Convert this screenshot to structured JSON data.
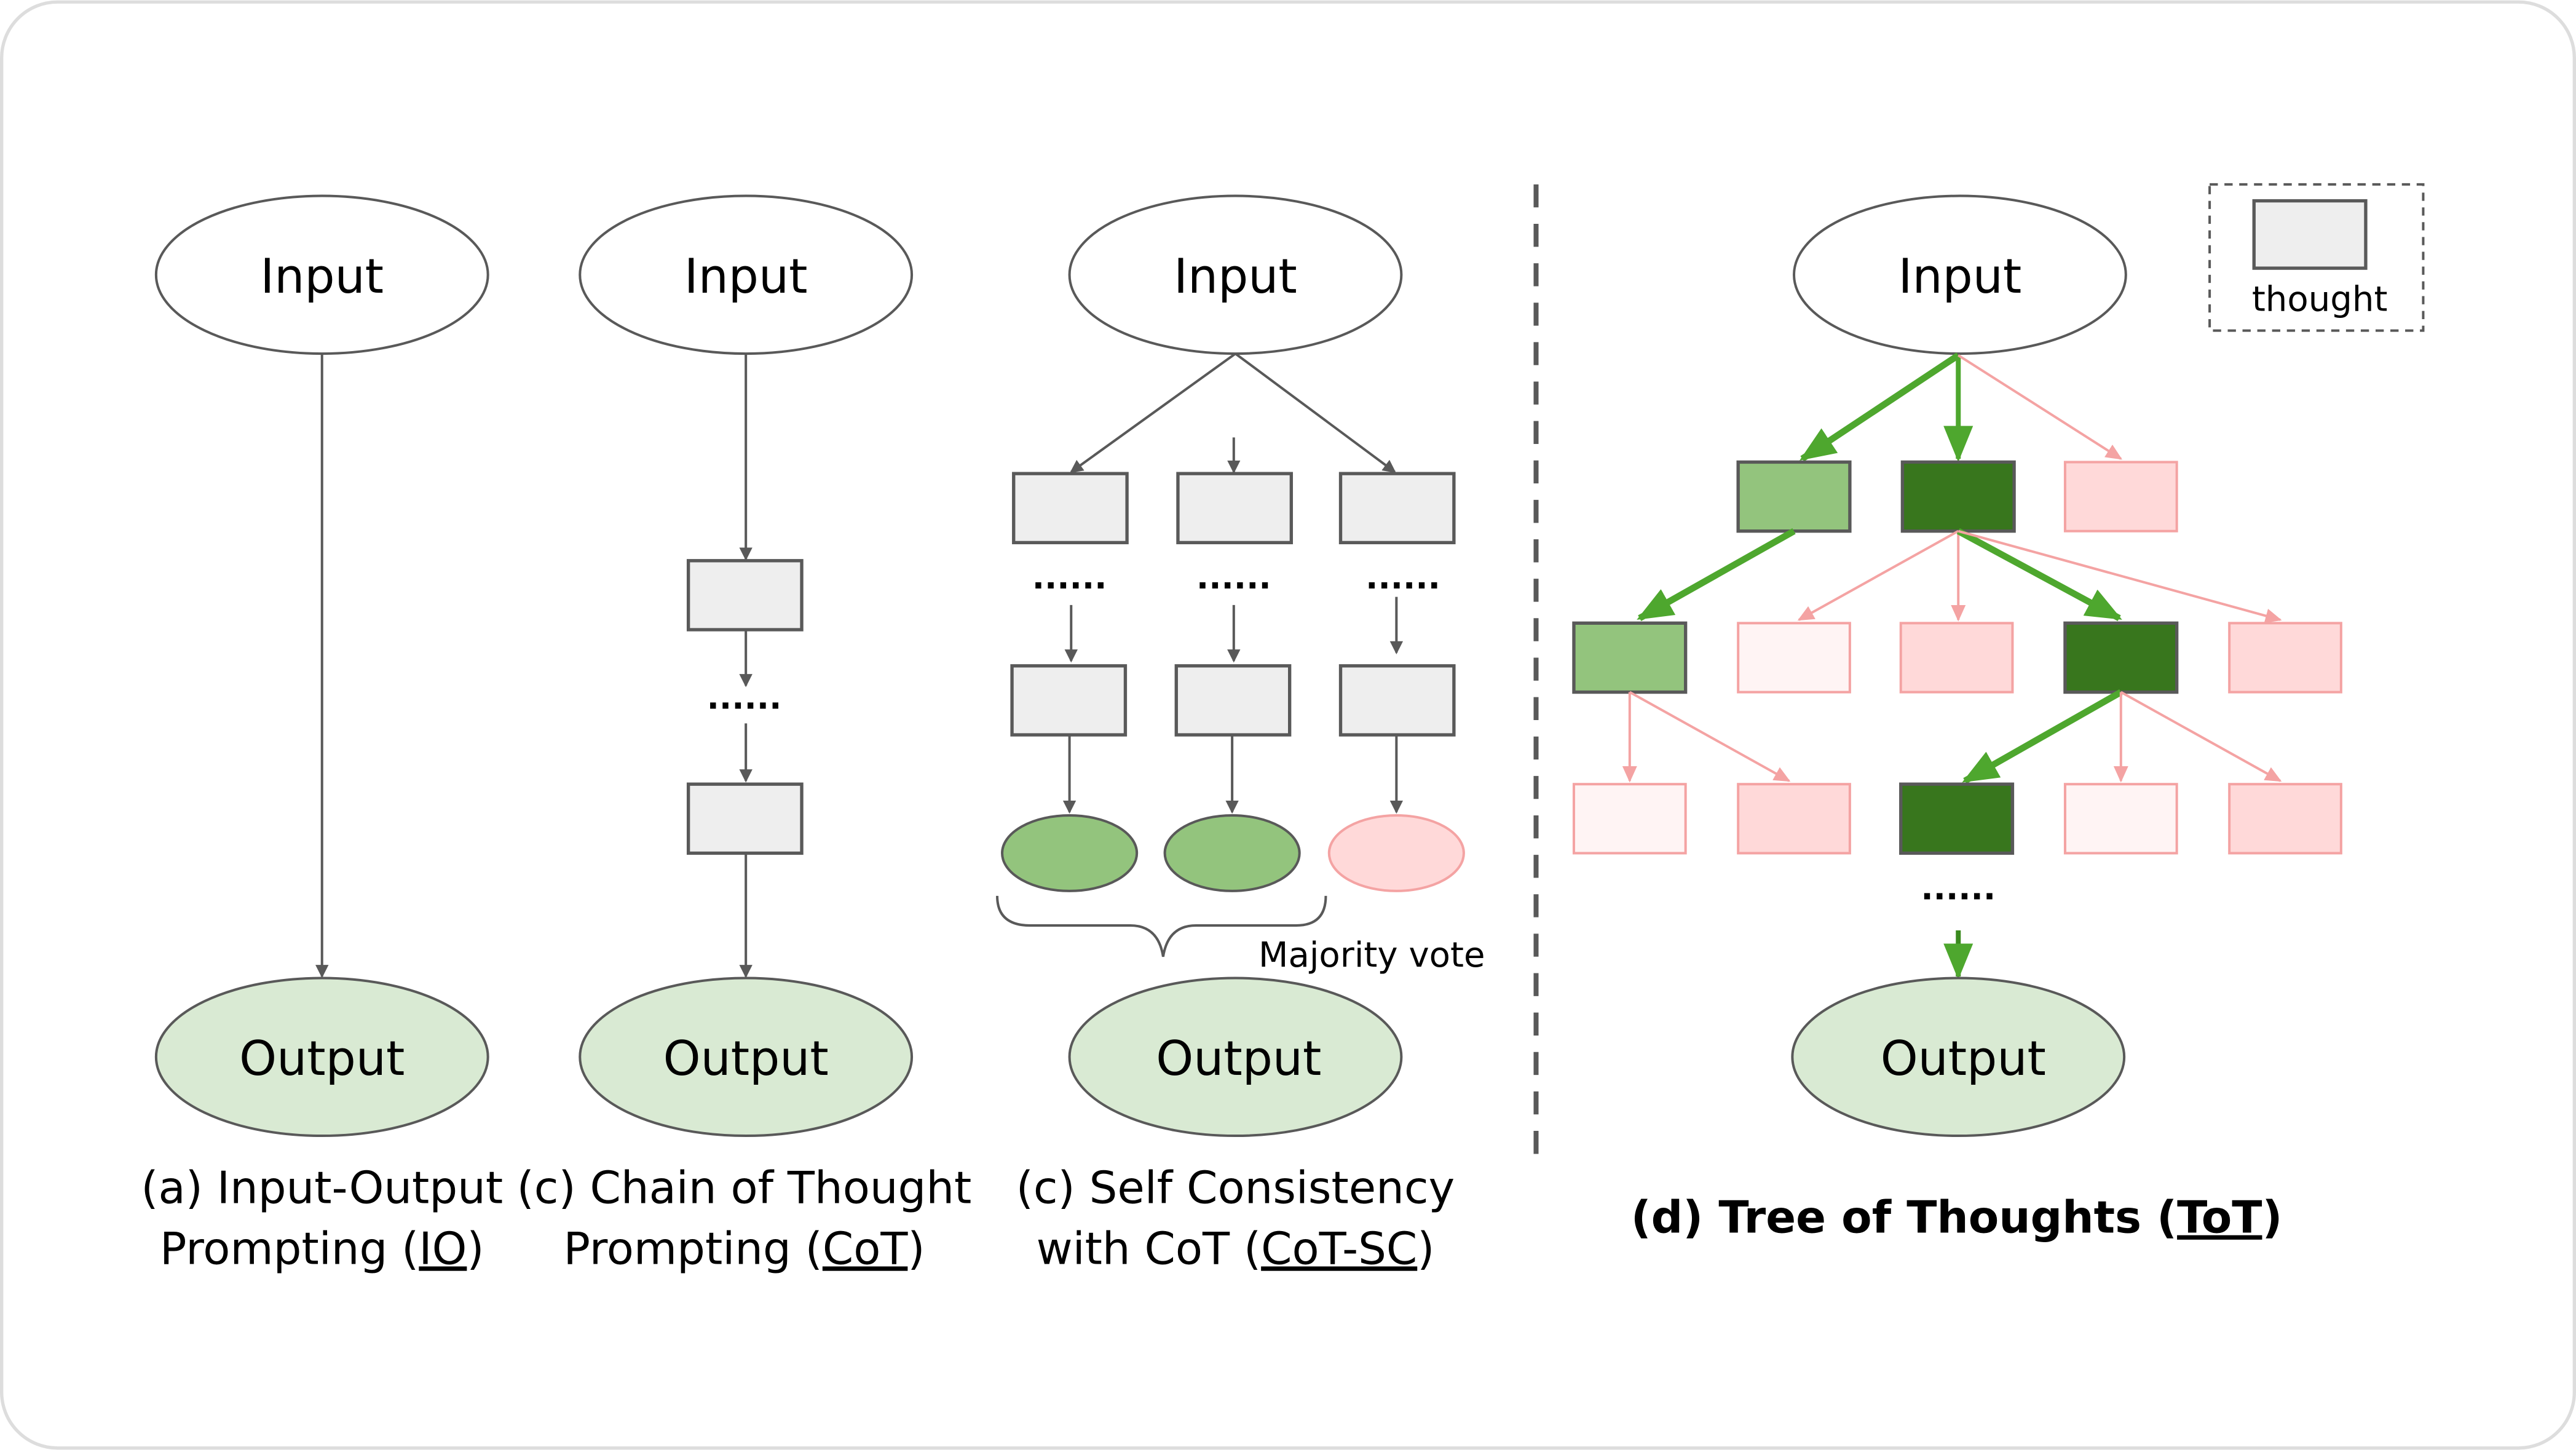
{
  "colors": {
    "stroke": "#595959",
    "thought_fill": "#eeeeee",
    "output_fill": "#d9ead3",
    "green_light": "#93c47d",
    "green_dark": "#38761d",
    "green_arrow": "#4ea72e",
    "pink_fill": "#ffd9d9",
    "pink_pale": "#fff4f4",
    "pink_stroke": "#f4a3a3"
  },
  "nodes": {
    "input": "Input",
    "output": "Output",
    "dots": "......"
  },
  "legend": {
    "label": "thought"
  },
  "panels": {
    "io": {
      "caption_line1": "(a) Input-Output",
      "caption_line2_pre": "Prompting (",
      "caption_line2_abbr": "IO",
      "caption_line2_post": ")"
    },
    "cot": {
      "caption_line1": "(c) Chain of Thought",
      "caption_line2_pre": "Prompting (",
      "caption_line2_abbr": "CoT",
      "caption_line2_post": ")"
    },
    "cotsc": {
      "caption_line1": "(c) Self Consistency",
      "caption_line2_pre": "with CoT (",
      "caption_line2_abbr": "CoT-SC",
      "caption_line2_post": ")",
      "majority_vote": "Majority vote"
    },
    "tot": {
      "caption_pre": "(d) Tree of Thoughts (",
      "caption_abbr": "ToT",
      "caption_post": ")"
    }
  }
}
